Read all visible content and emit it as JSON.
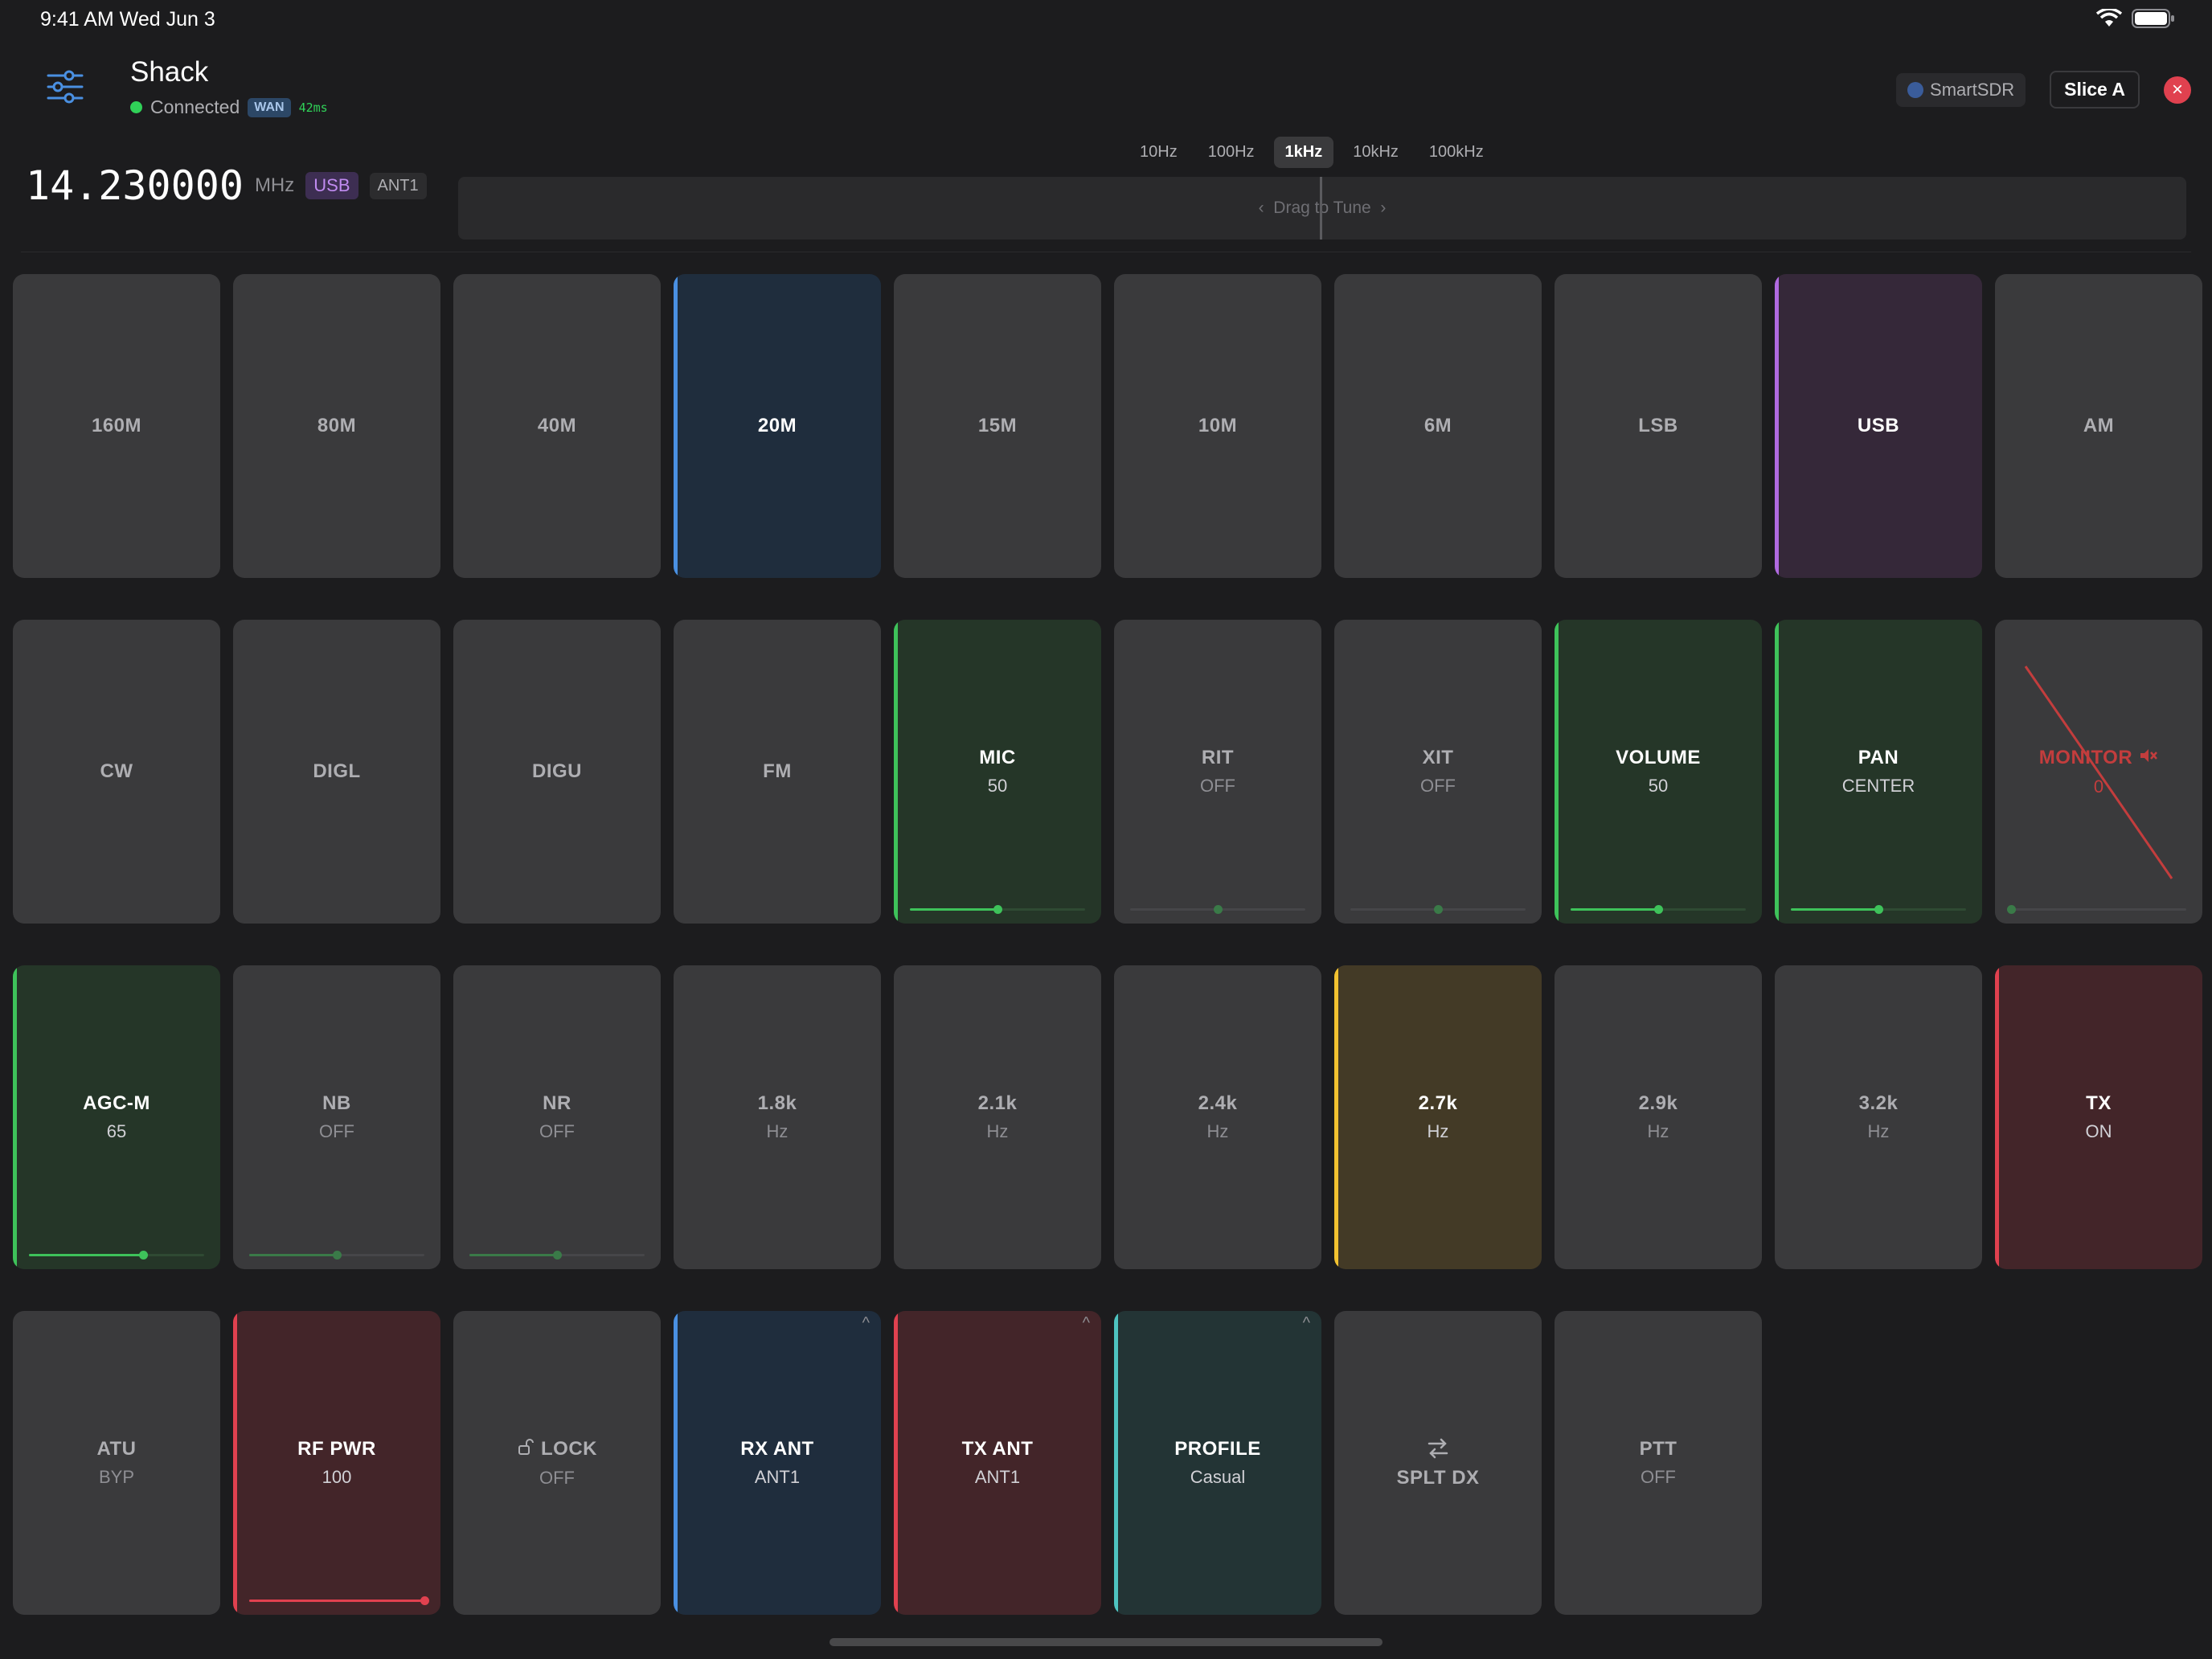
{
  "status_bar": {
    "time": "9:41 AM   Wed Jun 3"
  },
  "header": {
    "title": "Shack",
    "connection_status": "Connected",
    "wan_badge": "WAN",
    "latency": "42ms",
    "smartsdr_label": "SmartSDR",
    "slice_label": "Slice A",
    "close_icon": "close-icon",
    "menu_icon": "sliders-icon"
  },
  "steps": [
    "10Hz",
    "100Hz",
    "1kHz",
    "10kHz",
    "100kHz"
  ],
  "active_step": "1kHz",
  "frequency": {
    "value": "14.230000",
    "unit": "MHz",
    "mode": "USB",
    "antenna": "ANT1"
  },
  "tuner": {
    "label": "Drag to Tune"
  },
  "tiles": [
    {
      "label": "160M",
      "value": "",
      "state": "off"
    },
    {
      "label": "80M",
      "value": "",
      "state": "off"
    },
    {
      "label": "40M",
      "value": "",
      "state": "off"
    },
    {
      "label": "20M",
      "value": "",
      "state": "active",
      "color": "blue"
    },
    {
      "label": "15M",
      "value": "",
      "state": "off"
    },
    {
      "label": "10M",
      "value": "",
      "state": "off"
    },
    {
      "label": "6M",
      "value": "",
      "state": "off"
    },
    {
      "label": "LSB",
      "value": "",
      "state": "off"
    },
    {
      "label": "USB",
      "value": "",
      "state": "active",
      "color": "purple"
    },
    {
      "label": "AM",
      "value": "",
      "state": "off"
    },
    {
      "label": "CW",
      "value": "",
      "state": "off"
    },
    {
      "label": "DIGL",
      "value": "",
      "state": "off"
    },
    {
      "label": "DIGU",
      "value": "",
      "state": "off"
    },
    {
      "label": "FM",
      "value": "",
      "state": "off"
    },
    {
      "label": "MIC",
      "value": "50",
      "state": "active",
      "color": "green",
      "level": 0.5
    },
    {
      "label": "RIT",
      "value": "OFF",
      "state": "off",
      "level": 0.5,
      "slider_style": "dim-center"
    },
    {
      "label": "XIT",
      "value": "OFF",
      "state": "off",
      "level": 0.5,
      "slider_style": "dim-center"
    },
    {
      "label": "VOLUME",
      "value": "50",
      "state": "active",
      "color": "green",
      "level": 0.5
    },
    {
      "label": "PAN",
      "value": "CENTER",
      "state": "active",
      "color": "green",
      "level": 0.5
    },
    {
      "label": "MONITOR",
      "value": "0",
      "state": "muted",
      "level": 0.0,
      "icon": "speaker-muted-icon"
    },
    {
      "label": "AGC-M",
      "value": "65",
      "state": "active",
      "color": "green",
      "level": 0.65
    },
    {
      "label": "NB",
      "value": "OFF",
      "state": "off",
      "level": 0.5,
      "slider_style": "dim"
    },
    {
      "label": "NR",
      "value": "OFF",
      "state": "off",
      "level": 0.5,
      "slider_style": "dim"
    },
    {
      "label": "1.8k",
      "value": "Hz",
      "state": "off"
    },
    {
      "label": "2.1k",
      "value": "Hz",
      "state": "off"
    },
    {
      "label": "2.4k",
      "value": "Hz",
      "state": "off"
    },
    {
      "label": "2.7k",
      "value": "Hz",
      "state": "active",
      "color": "yellow"
    },
    {
      "label": "2.9k",
      "value": "Hz",
      "state": "off"
    },
    {
      "label": "3.2k",
      "value": "Hz",
      "state": "off"
    },
    {
      "label": "TX",
      "value": "ON",
      "state": "active",
      "color": "red"
    },
    {
      "label": "ATU",
      "value": "BYP",
      "state": "off"
    },
    {
      "label": "RF PWR",
      "value": "100",
      "state": "active",
      "color": "red",
      "level": 1.0,
      "slider_style": "red"
    },
    {
      "label": "LOCK",
      "value": "OFF",
      "state": "off",
      "icon": "unlock-icon"
    },
    {
      "label": "RX ANT",
      "value": "ANT1",
      "state": "active",
      "color": "blue",
      "caret": true
    },
    {
      "label": "TX ANT",
      "value": "ANT1",
      "state": "active",
      "color": "red",
      "caret": true
    },
    {
      "label": "PROFILE",
      "value": "Casual",
      "state": "active",
      "color": "teal",
      "caret": true
    },
    {
      "label": "SPLT DX",
      "value": "",
      "state": "off",
      "icon": "swap-arrows-icon"
    },
    {
      "label": "PTT",
      "value": "OFF",
      "state": "off"
    }
  ],
  "colors": {
    "blue": "#4a90e2",
    "purple": "#b06ae0",
    "green": "#3ec25a",
    "yellow": "#f2c230",
    "red": "#e0414f",
    "teal": "#4ec3c0"
  }
}
